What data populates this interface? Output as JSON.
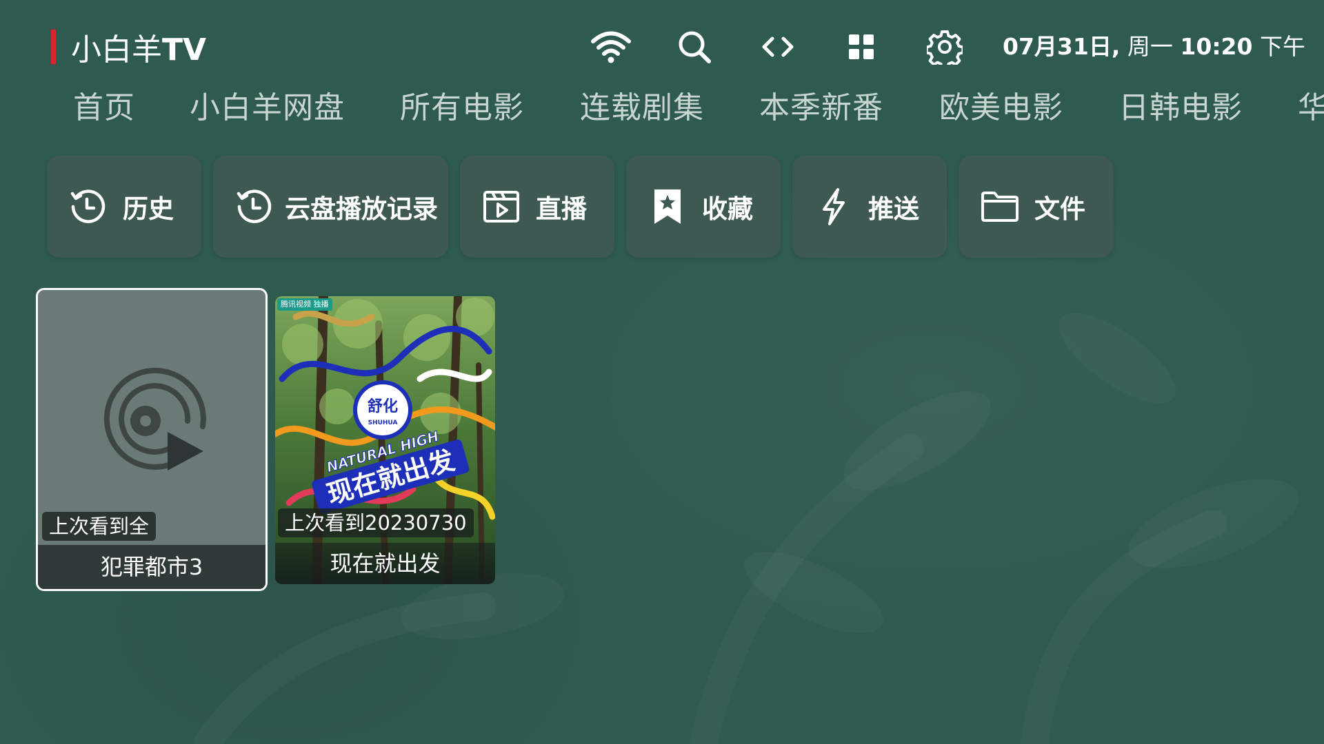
{
  "header": {
    "brand_name": "小白羊",
    "brand_suffix": "TV",
    "brand_color": "#d62a2a",
    "icons": [
      "wifi-icon",
      "search-icon",
      "code-arrows-icon",
      "grid-icon",
      "gear-icon"
    ],
    "datetime": {
      "date": "07月31日,",
      "weekday": "周一",
      "time": "10:20",
      "period": "下午"
    }
  },
  "nav": {
    "tabs": [
      {
        "label": "首页"
      },
      {
        "label": "小白羊网盘"
      },
      {
        "label": "所有电影"
      },
      {
        "label": "连载剧集"
      },
      {
        "label": "本季新番"
      },
      {
        "label": "欧美电影"
      },
      {
        "label": "日韩电影"
      },
      {
        "label": "华"
      }
    ]
  },
  "shortcuts": [
    {
      "label": "历史",
      "icon": "history-icon"
    },
    {
      "label": "云盘播放记录",
      "icon": "history-icon"
    },
    {
      "label": "直播",
      "icon": "live-video-icon"
    },
    {
      "label": "收藏",
      "icon": "bookmark-star-icon"
    },
    {
      "label": "推送",
      "icon": "lightning-icon"
    },
    {
      "label": "文件",
      "icon": "folder-icon"
    }
  ],
  "history_cards": [
    {
      "title": "犯罪都市3",
      "progress": "上次看到全",
      "focused": true,
      "artwork": "placeholder-play-icon"
    },
    {
      "title": "现在就出发",
      "progress": "上次看到20230730",
      "focused": false,
      "artwork": "poster",
      "poster_text": {
        "tag": "腾讯视频 独播",
        "badge_main": "舒化",
        "badge_sub": "SHUHUA",
        "series_latin": "NATURAL HIGH",
        "series_title": "现在就出发"
      }
    }
  ],
  "colors": {
    "background": "#2e5a50",
    "button_bg": "#3e5852",
    "tab_text": "#c8d5d0",
    "focus_border": "#ffffff"
  }
}
